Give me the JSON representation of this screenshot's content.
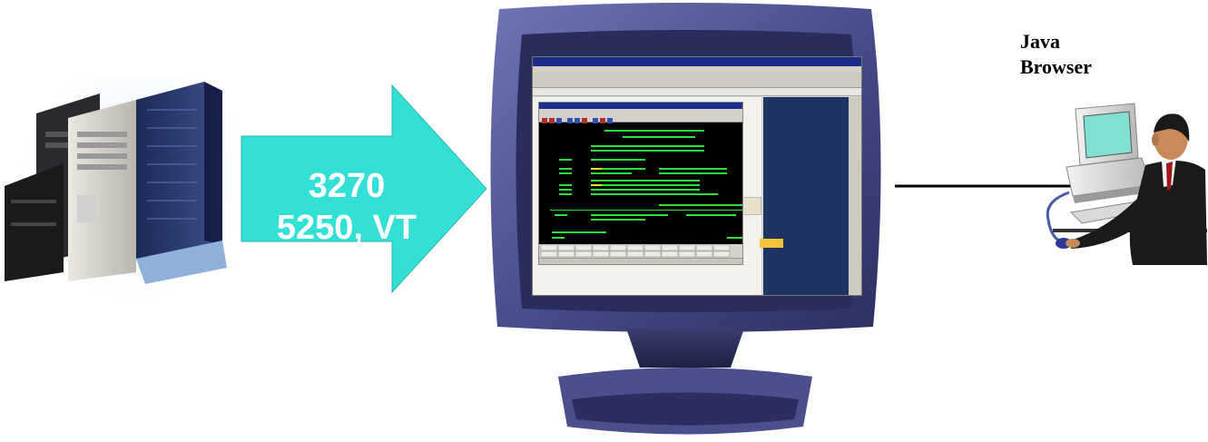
{
  "arrow": {
    "line1": "3270",
    "line2": "5250, VT",
    "fill_color": "#33e0d6"
  },
  "client": {
    "label_line1": "Java",
    "label_line2": "Browser"
  },
  "monitor": {
    "bezel_color": "#4a4f8f"
  },
  "icons": {
    "server": "server-rack-icon",
    "monitor": "crt-monitor-icon",
    "user": "user-at-computer-icon"
  }
}
